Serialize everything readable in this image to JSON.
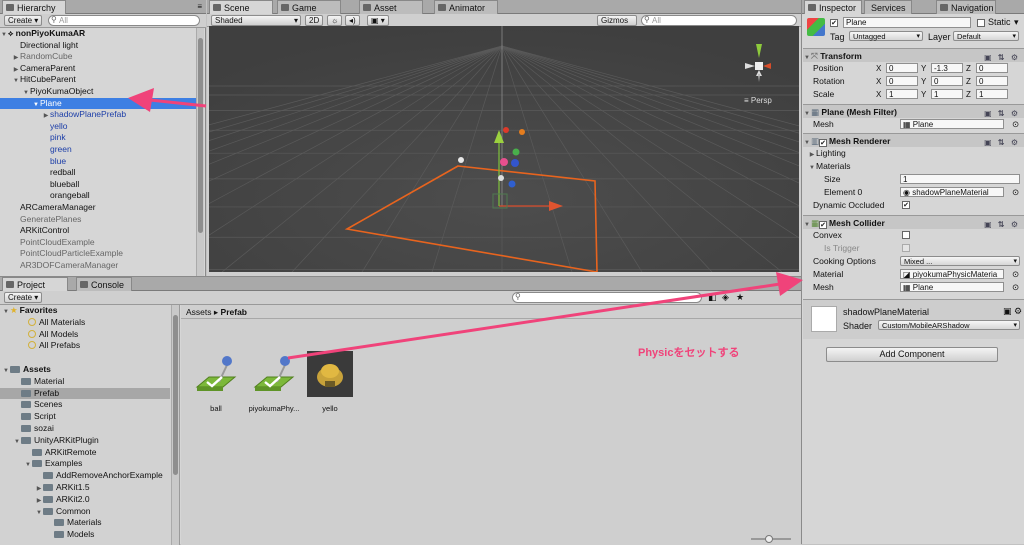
{
  "hierarchy": {
    "tab_label": "Hierarchy",
    "create_label": "Create",
    "search_placeholder": "All",
    "scene_name": "nonPiyoKumaAR",
    "items": [
      {
        "label": "Directional light",
        "indent": 1,
        "style": "normal",
        "expander": ""
      },
      {
        "label": "RandomCube",
        "indent": 1,
        "style": "grey",
        "expander": "▶"
      },
      {
        "label": "CameraParent",
        "indent": 1,
        "style": "normal",
        "expander": "▶"
      },
      {
        "label": "HitCubeParent",
        "indent": 1,
        "style": "normal",
        "expander": "▼"
      },
      {
        "label": "PiyoKumaObject",
        "indent": 2,
        "style": "normal",
        "expander": "▼"
      },
      {
        "label": "Plane",
        "indent": 3,
        "style": "selected",
        "expander": "▼"
      },
      {
        "label": "shadowPlanePrefab",
        "indent": 4,
        "style": "blue",
        "expander": "▶"
      },
      {
        "label": "yello",
        "indent": 4,
        "style": "blue",
        "expander": ""
      },
      {
        "label": "pink",
        "indent": 4,
        "style": "blue",
        "expander": ""
      },
      {
        "label": "green",
        "indent": 4,
        "style": "blue",
        "expander": ""
      },
      {
        "label": "blue",
        "indent": 4,
        "style": "blue",
        "expander": ""
      },
      {
        "label": "redball",
        "indent": 4,
        "style": "normal",
        "expander": ""
      },
      {
        "label": "blueball",
        "indent": 4,
        "style": "normal",
        "expander": ""
      },
      {
        "label": "orangeball",
        "indent": 4,
        "style": "normal",
        "expander": ""
      },
      {
        "label": "ARCameraManager",
        "indent": 1,
        "style": "normal",
        "expander": ""
      },
      {
        "label": "GeneratePlanes",
        "indent": 1,
        "style": "grey",
        "expander": ""
      },
      {
        "label": "ARKitControl",
        "indent": 1,
        "style": "normal",
        "expander": ""
      },
      {
        "label": "PointCloudExample",
        "indent": 1,
        "style": "grey",
        "expander": ""
      },
      {
        "label": "PointCloudParticleExample",
        "indent": 1,
        "style": "grey",
        "expander": ""
      },
      {
        "label": "AR3DOFCameraManager",
        "indent": 1,
        "style": "grey",
        "expander": ""
      }
    ]
  },
  "scene": {
    "tabs": [
      "Scene",
      "Game",
      "Asset Store",
      "Animator"
    ],
    "shading": "Shaded",
    "mode_2d": "2D",
    "gizmos": "Gizmos",
    "search_placeholder": "All",
    "persp_label": "≡ Persp"
  },
  "project": {
    "tabs": [
      "Project",
      "Console"
    ],
    "create_label": "Create",
    "favorites_label": "Favorites",
    "favorites": [
      "All Materials",
      "All Models",
      "All Prefabs"
    ],
    "tree": [
      {
        "label": "Assets",
        "indent": 0,
        "expander": "▼",
        "bold": true
      },
      {
        "label": "Material",
        "indent": 1,
        "expander": ""
      },
      {
        "label": "Prefab",
        "indent": 1,
        "expander": "",
        "selected": true
      },
      {
        "label": "Scenes",
        "indent": 1,
        "expander": ""
      },
      {
        "label": "Script",
        "indent": 1,
        "expander": ""
      },
      {
        "label": "sozai",
        "indent": 1,
        "expander": ""
      },
      {
        "label": "UnityARKitPlugin",
        "indent": 1,
        "expander": "▼"
      },
      {
        "label": "ARKitRemote",
        "indent": 2,
        "expander": ""
      },
      {
        "label": "Examples",
        "indent": 2,
        "expander": "▼"
      },
      {
        "label": "AddRemoveAnchorExample",
        "indent": 3,
        "expander": ""
      },
      {
        "label": "ARKit1.5",
        "indent": 3,
        "expander": "▶"
      },
      {
        "label": "ARKit2.0",
        "indent": 3,
        "expander": "▶"
      },
      {
        "label": "Common",
        "indent": 3,
        "expander": "▼"
      },
      {
        "label": "Materials",
        "indent": 4,
        "expander": ""
      },
      {
        "label": "Models",
        "indent": 4,
        "expander": ""
      }
    ],
    "breadcrumb": [
      "Assets",
      "Prefab"
    ],
    "assets": [
      "ball",
      "piyokumaPhy...",
      "yello"
    ]
  },
  "annotation": {
    "text": "Physicをセットする",
    "color": "#f0437a"
  },
  "inspector": {
    "tabs": [
      "Inspector",
      "Services",
      "Navigation"
    ],
    "object_name": "Plane",
    "static_label": "Static",
    "tag_label": "Tag",
    "tag_value": "Untagged",
    "layer_label": "Layer",
    "layer_value": "Default",
    "transform": {
      "title": "Transform",
      "rows": [
        {
          "label": "Position",
          "x": "0",
          "y": "-1.3",
          "z": "0"
        },
        {
          "label": "Rotation",
          "x": "0",
          "y": "0",
          "z": "0"
        },
        {
          "label": "Scale",
          "x": "1",
          "y": "1",
          "z": "1"
        }
      ]
    },
    "mesh_filter": {
      "title": "Plane (Mesh Filter)",
      "mesh_label": "Mesh",
      "mesh_value": "Plane"
    },
    "mesh_renderer": {
      "title": "Mesh Renderer",
      "lighting": "Lighting",
      "materials": "Materials",
      "size_label": "Size",
      "size_value": "1",
      "element_label": "Element 0",
      "element_value": "shadowPlaneMaterial",
      "dynamic_label": "Dynamic Occluded"
    },
    "mesh_collider": {
      "title": "Mesh Collider",
      "convex": "Convex",
      "trigger": "Is Trigger",
      "cooking_label": "Cooking Options",
      "cooking_value": "Mixed ...",
      "material_label": "Material",
      "material_value": "piyokumaPhysicMateria",
      "mesh_label": "Mesh",
      "mesh_value": "Plane"
    },
    "material": {
      "name": "shadowPlaneMaterial",
      "shader_label": "Shader",
      "shader_value": "Custom/MobileARShadow"
    },
    "add_component": "Add Component"
  }
}
